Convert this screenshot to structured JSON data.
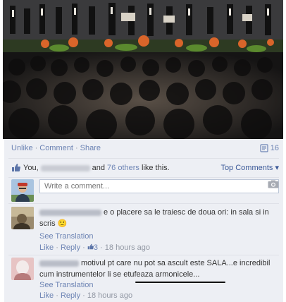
{
  "actions": {
    "unlike": "Unlike",
    "comment": "Comment",
    "share": "Share",
    "sep": "·",
    "share_count": "16"
  },
  "likes": {
    "prefix": "You,",
    "middle": "and",
    "others": "76 others",
    "suffix": "like this.",
    "top_comments": "Top Comments ▾"
  },
  "composer": {
    "placeholder": "Write a comment..."
  },
  "comments": [
    {
      "text": "e o placere sa le traiesc de doua ori: in sala si in scris 🙂",
      "see_translation": "See Translation",
      "like": "Like",
      "reply": "Reply",
      "likes": "3",
      "time": "18 hours ago"
    },
    {
      "text": "motivul pt care nu pot sa ascult este SALA...e incredibil cum instrumentelor li se etufeaza armonicele...",
      "see_translation": "See Translation",
      "like": "Like",
      "reply": "Reply",
      "time": "18 hours ago"
    }
  ],
  "colors": {
    "link": "#6d84b4",
    "panel": "#edeff4",
    "name": "#3b5998"
  }
}
